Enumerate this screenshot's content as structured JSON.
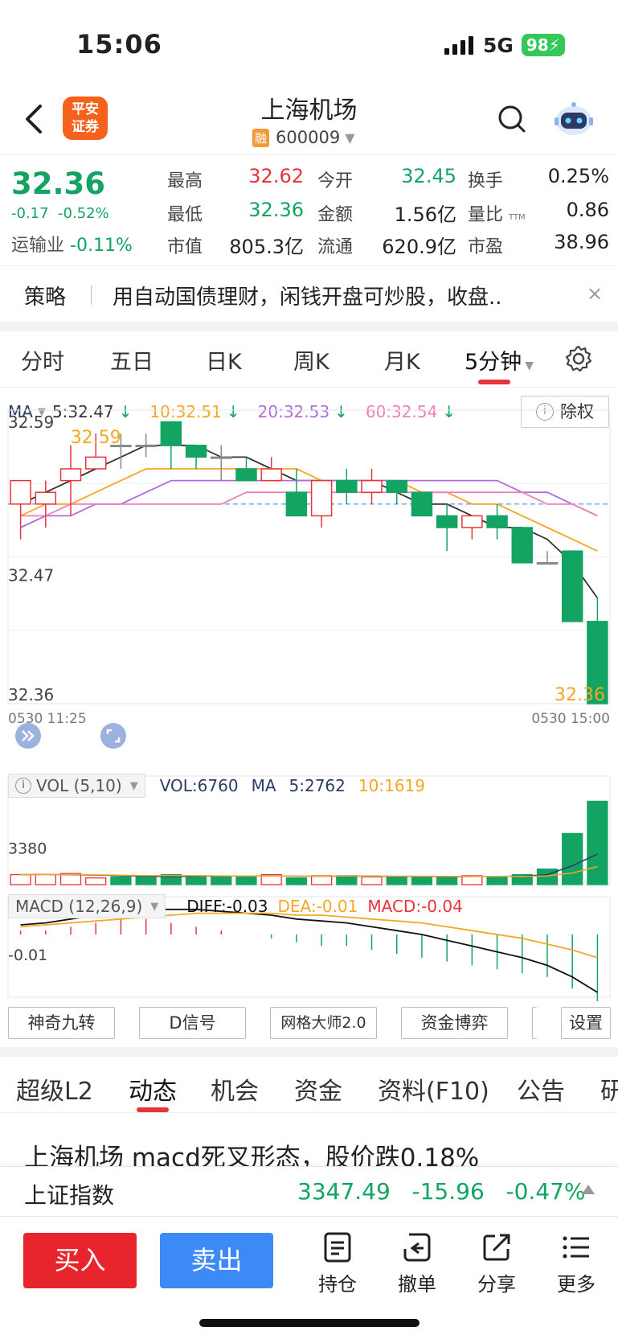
{
  "status_bar": {
    "time": "15:06",
    "network": "5G",
    "battery": "98"
  },
  "header": {
    "broker_logo": "平安证券",
    "stock_name": "上海机场",
    "rong_badge": "融",
    "stock_code": "600009"
  },
  "quote": {
    "price": "32.36",
    "change": "-0.17",
    "change_pct": "-0.52%",
    "sector_name": "运输业",
    "sector_change": "-0.11%",
    "fields": [
      {
        "label": "最高",
        "value": "32.62"
      },
      {
        "label": "今开",
        "value": "32.45"
      },
      {
        "label": "换手",
        "value": "0.25%"
      },
      {
        "label": "最低",
        "value": "32.36"
      },
      {
        "label": "金额",
        "value": "1.56亿"
      },
      {
        "label": "量比",
        "value": "0.86"
      },
      {
        "label": "市值",
        "value": "805.3亿"
      },
      {
        "label": "流通",
        "value": "620.9亿"
      },
      {
        "label": "市盈",
        "value": "38.96"
      }
    ],
    "pe_superscript": "TTM"
  },
  "strategy": {
    "tag": "策略",
    "text": "用自动国债理财，闲钱开盘可炒股，收盘..",
    "close": "×"
  },
  "period_tabs": [
    "分时",
    "五日",
    "日K",
    "周K",
    "月K",
    "5分钟"
  ],
  "active_period": "5分钟",
  "ma_legend": {
    "label": "MA",
    "ma5": "5:32.47",
    "ma10": "10:32.51",
    "ma20": "20:32.53",
    "ma60": "60:32.54"
  },
  "fq_button": "除权",
  "chart_data": {
    "type": "candlestick",
    "interval": "5分钟",
    "y_axis_labels": [
      "32.59",
      "32.47",
      "32.36"
    ],
    "ylim": [
      32.36,
      32.61
    ],
    "max_marker": "32.59",
    "min_marker": "32.36",
    "x_axis_labels": [
      "0530 11:25",
      "0530 15:00"
    ],
    "reference_line": 32.53,
    "candles": [
      {
        "o": 32.53,
        "h": 32.55,
        "l": 32.5,
        "c": 32.55
      },
      {
        "o": 32.53,
        "h": 32.55,
        "l": 32.51,
        "c": 32.54
      },
      {
        "o": 32.55,
        "h": 32.58,
        "l": 32.52,
        "c": 32.56
      },
      {
        "o": 32.56,
        "h": 32.59,
        "l": 32.56,
        "c": 32.57
      },
      {
        "o": 32.58,
        "h": 32.59,
        "l": 32.56,
        "c": 32.58
      },
      {
        "o": 32.58,
        "h": 32.59,
        "l": 32.57,
        "c": 32.58
      },
      {
        "o": 32.6,
        "h": 32.6,
        "l": 32.56,
        "c": 32.58
      },
      {
        "o": 32.58,
        "h": 32.58,
        "l": 32.56,
        "c": 32.57
      },
      {
        "o": 32.57,
        "h": 32.58,
        "l": 32.55,
        "c": 32.57
      },
      {
        "o": 32.56,
        "h": 32.57,
        "l": 32.55,
        "c": 32.55
      },
      {
        "o": 32.55,
        "h": 32.57,
        "l": 32.55,
        "c": 32.56
      },
      {
        "o": 32.54,
        "h": 32.56,
        "l": 32.52,
        "c": 32.52
      },
      {
        "o": 32.52,
        "h": 32.55,
        "l": 32.51,
        "c": 32.55
      },
      {
        "o": 32.55,
        "h": 32.56,
        "l": 32.53,
        "c": 32.54
      },
      {
        "o": 32.54,
        "h": 32.56,
        "l": 32.53,
        "c": 32.55
      },
      {
        "o": 32.55,
        "h": 32.55,
        "l": 32.53,
        "c": 32.54
      },
      {
        "o": 32.54,
        "h": 32.54,
        "l": 32.52,
        "c": 32.52
      },
      {
        "o": 32.52,
        "h": 32.53,
        "l": 32.49,
        "c": 32.51
      },
      {
        "o": 32.51,
        "h": 32.52,
        "l": 32.5,
        "c": 32.52
      },
      {
        "o": 32.52,
        "h": 32.53,
        "l": 32.5,
        "c": 32.51
      },
      {
        "o": 32.51,
        "h": 32.51,
        "l": 32.48,
        "c": 32.48
      },
      {
        "o": 32.48,
        "h": 32.49,
        "l": 32.48,
        "c": 32.48
      },
      {
        "o": 32.49,
        "h": 32.49,
        "l": 32.43,
        "c": 32.43
      },
      {
        "o": 32.43,
        "h": 32.45,
        "l": 32.36,
        "c": 32.36
      }
    ],
    "ma_lines": [
      {
        "name": "5",
        "values": [
          32.53,
          32.54,
          32.55,
          32.56,
          32.57,
          32.58,
          32.58,
          32.58,
          32.57,
          32.57,
          32.56,
          32.55,
          32.55,
          32.55,
          32.55,
          32.54,
          32.53,
          32.53,
          32.52,
          32.51,
          32.51,
          32.5,
          32.48,
          32.45
        ]
      },
      {
        "name": "10",
        "values": [
          32.52,
          32.53,
          32.53,
          32.54,
          32.55,
          32.56,
          32.56,
          32.56,
          32.56,
          32.56,
          32.56,
          32.56,
          32.55,
          32.55,
          32.55,
          32.55,
          32.54,
          32.54,
          32.53,
          32.53,
          32.52,
          32.51,
          32.5,
          32.49
        ]
      },
      {
        "name": "20",
        "values": [
          32.51,
          32.52,
          32.52,
          32.53,
          32.53,
          32.54,
          32.55,
          32.55,
          32.55,
          32.55,
          32.55,
          32.55,
          32.55,
          32.55,
          32.55,
          32.55,
          32.55,
          32.55,
          32.55,
          32.55,
          32.54,
          32.54,
          32.53,
          32.52
        ]
      },
      {
        "name": "60",
        "values": [
          32.52,
          32.52,
          32.53,
          32.53,
          32.53,
          32.53,
          32.53,
          32.53,
          32.53,
          32.54,
          32.54,
          32.54,
          32.54,
          32.54,
          32.54,
          32.54,
          32.54,
          32.54,
          32.54,
          32.54,
          32.54,
          32.53,
          32.53,
          32.52
        ]
      }
    ],
    "volume": {
      "legend": {
        "label": "VOL (5,10)",
        "vol": "VOL:6760",
        "ma": "MA",
        "ma5": "5:2762",
        "ma10": "10:1619"
      },
      "y_label": "3380",
      "values": [
        900,
        900,
        1000,
        600,
        700,
        700,
        900,
        800,
        700,
        700,
        900,
        600,
        800,
        800,
        700,
        700,
        700,
        700,
        800,
        700,
        900,
        1400,
        4600,
        7500
      ]
    },
    "macd": {
      "legend": {
        "label": "MACD (12,26,9)",
        "diff": "DIFF:-0.03",
        "dea": "DEA:-0.01",
        "macd": "MACD:-0.04"
      },
      "y_label": "-0.01"
    }
  },
  "tools": [
    "神奇九转",
    "D信号",
    "网格大师2.0",
    "资金博弈",
    "设置"
  ],
  "info_tabs": [
    "超级L2",
    "动态",
    "机会",
    "资金",
    "资料(F10)",
    "公告",
    "研"
  ],
  "active_info_tab": "动态",
  "news_title": "上海机场 macd死叉形态，股价跌0.18%",
  "index_bar": {
    "name": "上证指数",
    "value": "3347.49",
    "change": "-15.96",
    "change_pct": "-0.47%"
  },
  "bottom_bar": {
    "buy": "买入",
    "sell": "卖出",
    "items": [
      {
        "label": "持仓",
        "icon": "position-icon"
      },
      {
        "label": "撤单",
        "icon": "cancel-order-icon"
      },
      {
        "label": "分享",
        "icon": "share-icon"
      },
      {
        "label": "更多",
        "icon": "more-icon"
      }
    ]
  },
  "colors": {
    "up": "#e8333b",
    "down": "#13a463",
    "ma5": "#333333",
    "ma10": "#f5a623",
    "ma20": "#b26bd9",
    "ma60": "#ef7fb8",
    "buy": "#e8242d",
    "sell": "#3d8af7"
  }
}
